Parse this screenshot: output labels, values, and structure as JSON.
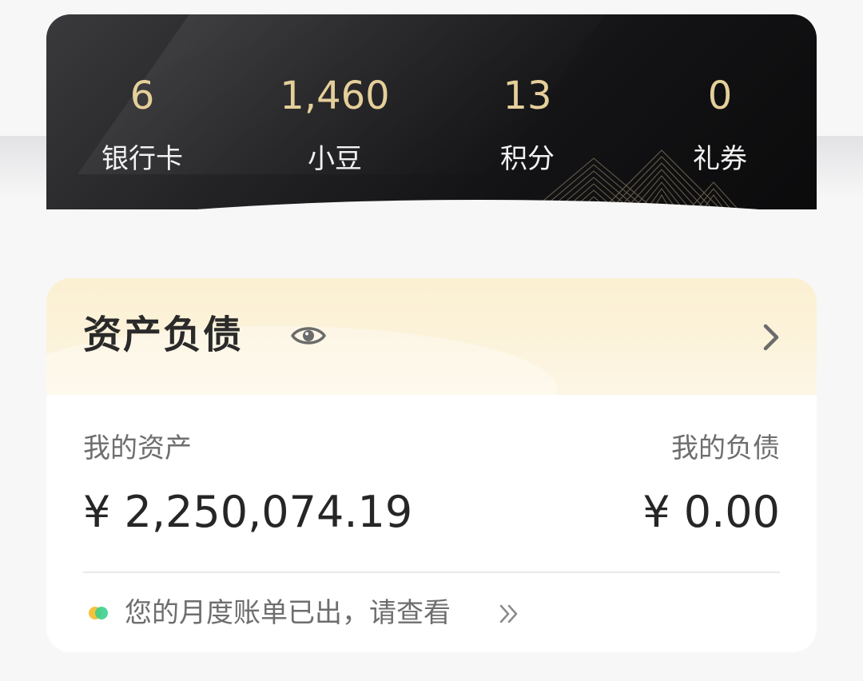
{
  "stats": [
    {
      "value": "6",
      "label": "银行卡"
    },
    {
      "value": "1,460",
      "label": "小豆"
    },
    {
      "value": "13",
      "label": "积分"
    },
    {
      "value": "0",
      "label": "礼券"
    }
  ],
  "asset_card": {
    "title": "资产负债",
    "eye_icon": "eye-icon",
    "chevron_icon": "chevron-right-icon",
    "assets_label": "我的资产",
    "assets_value": "¥ 2,250,074.19",
    "liabilities_label": "我的负债",
    "liabilities_value": "¥ 0.00",
    "notice_text": "您的月度账单已出，请查看",
    "notice_icon": "double-chevron-right-icon"
  },
  "colors": {
    "stat_value": "#e5cf9a",
    "stat_label": "#f2f2f2",
    "header_bg": "#fbf0d2",
    "notice_dot_green": "#3ccf8e",
    "notice_dot_yellow": "#f6c23c"
  }
}
